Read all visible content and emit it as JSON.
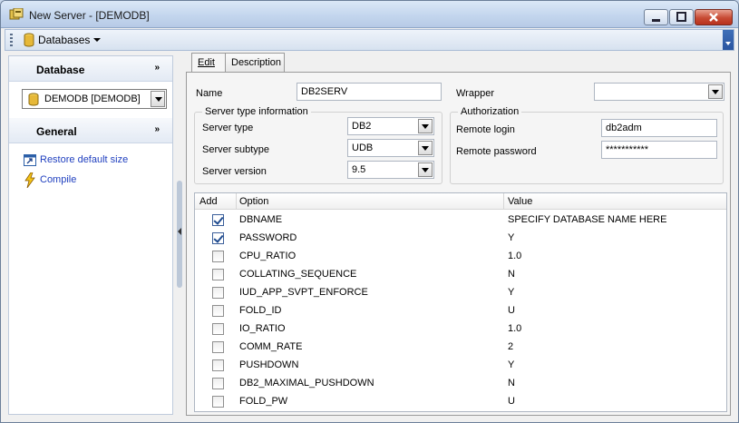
{
  "window": {
    "title": "New Server - [DEMODB]"
  },
  "toolbar": {
    "databases_label": "Databases"
  },
  "sidebar": {
    "database_header": "Database",
    "database_value": "DEMODB [DEMODB]",
    "general_header": "General",
    "links": [
      {
        "label": "Restore default size",
        "icon": "restore-size-icon"
      },
      {
        "label": "Compile",
        "icon": "lightning-icon"
      }
    ]
  },
  "tabs": [
    {
      "label": "Edit"
    },
    {
      "label": "Description"
    }
  ],
  "form": {
    "name_label": "Name",
    "name_value": "DB2SERV",
    "wrapper_label": "Wrapper",
    "wrapper_value": "",
    "server_group_title": "Server type information",
    "server_type_label": "Server type",
    "server_type_value": "DB2",
    "server_subtype_label": "Server subtype",
    "server_subtype_value": "UDB",
    "server_version_label": "Server version",
    "server_version_value": "9.5",
    "auth_group_title": "Authorization",
    "remote_login_label": "Remote login",
    "remote_login_value": "db2adm",
    "remote_password_label": "Remote password",
    "remote_password_value": "***********"
  },
  "grid": {
    "columns": [
      "Add",
      "Option",
      "Value"
    ],
    "rows": [
      {
        "checked": true,
        "option": "DBNAME",
        "value": "SPECIFY DATABASE NAME HERE"
      },
      {
        "checked": true,
        "option": "PASSWORD",
        "value": "Y"
      },
      {
        "checked": false,
        "option": "CPU_RATIO",
        "value": "1.0"
      },
      {
        "checked": false,
        "option": "COLLATING_SEQUENCE",
        "value": "N"
      },
      {
        "checked": false,
        "option": "IUD_APP_SVPT_ENFORCE",
        "value": "Y"
      },
      {
        "checked": false,
        "option": "FOLD_ID",
        "value": "U"
      },
      {
        "checked": false,
        "option": "IO_RATIO",
        "value": "1.0"
      },
      {
        "checked": false,
        "option": "COMM_RATE",
        "value": "2"
      },
      {
        "checked": false,
        "option": "PUSHDOWN",
        "value": "Y"
      },
      {
        "checked": false,
        "option": "DB2_MAXIMAL_PUSHDOWN",
        "value": "N"
      },
      {
        "checked": false,
        "option": "FOLD_PW",
        "value": "U"
      }
    ]
  }
}
